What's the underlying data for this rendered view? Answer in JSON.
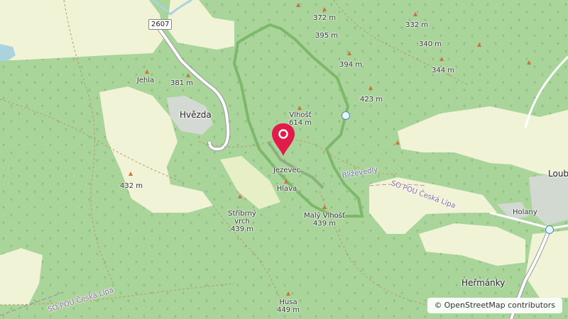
{
  "map": {
    "colors": {
      "forest": "#a9d49a",
      "meadow": "#f1f3d6",
      "marker": "#e21b4b",
      "boundary": "#75b364",
      "water": "#aad3df"
    },
    "road_shield": "2607",
    "places": [
      {
        "id": "hvezda",
        "name": "Hvězda"
      },
      {
        "id": "loubi",
        "name": "Loubí"
      },
      {
        "id": "hermanky",
        "name": "Heřmánky"
      },
      {
        "id": "holany",
        "name": "Holany"
      }
    ],
    "peaks": [
      {
        "id": "jehla",
        "name": "Jehla",
        "elev": ""
      },
      {
        "id": "p381",
        "name": "",
        "elev": "381 m"
      },
      {
        "id": "vlhost",
        "name": "Vlhošť",
        "elev": "614 m"
      },
      {
        "id": "jezevec",
        "name": "Jezevec",
        "elev": ""
      },
      {
        "id": "hlava",
        "name": "Hlava",
        "elev": ""
      },
      {
        "id": "maly-vlhost",
        "name": "Malý Vlhošť",
        "elev": "439 m"
      },
      {
        "id": "stribrny",
        "name": "Stříbrný vrch",
        "elev": "439 m"
      },
      {
        "id": "husa",
        "name": "Husa",
        "elev": "449 m"
      },
      {
        "id": "p432",
        "name": "",
        "elev": "432 m"
      },
      {
        "id": "p372",
        "name": "",
        "elev": "372 m"
      },
      {
        "id": "p395",
        "name": "",
        "elev": "395 m"
      },
      {
        "id": "p394",
        "name": "",
        "elev": "394 m"
      },
      {
        "id": "p423",
        "name": "",
        "elev": "423 m"
      },
      {
        "id": "p332",
        "name": "",
        "elev": "332 m"
      },
      {
        "id": "p340",
        "name": "",
        "elev": "340 m"
      },
      {
        "id": "p344",
        "name": "",
        "elev": "344 m"
      }
    ],
    "area_labels": {
      "blizevedly": "Blíževedly",
      "sopou_east": "SO POU Česká Lípa",
      "sopou_west": "SO POU Česká Lípa"
    },
    "attribution": {
      "symbol": "©",
      "text": "OpenStreetMap contributors"
    }
  }
}
